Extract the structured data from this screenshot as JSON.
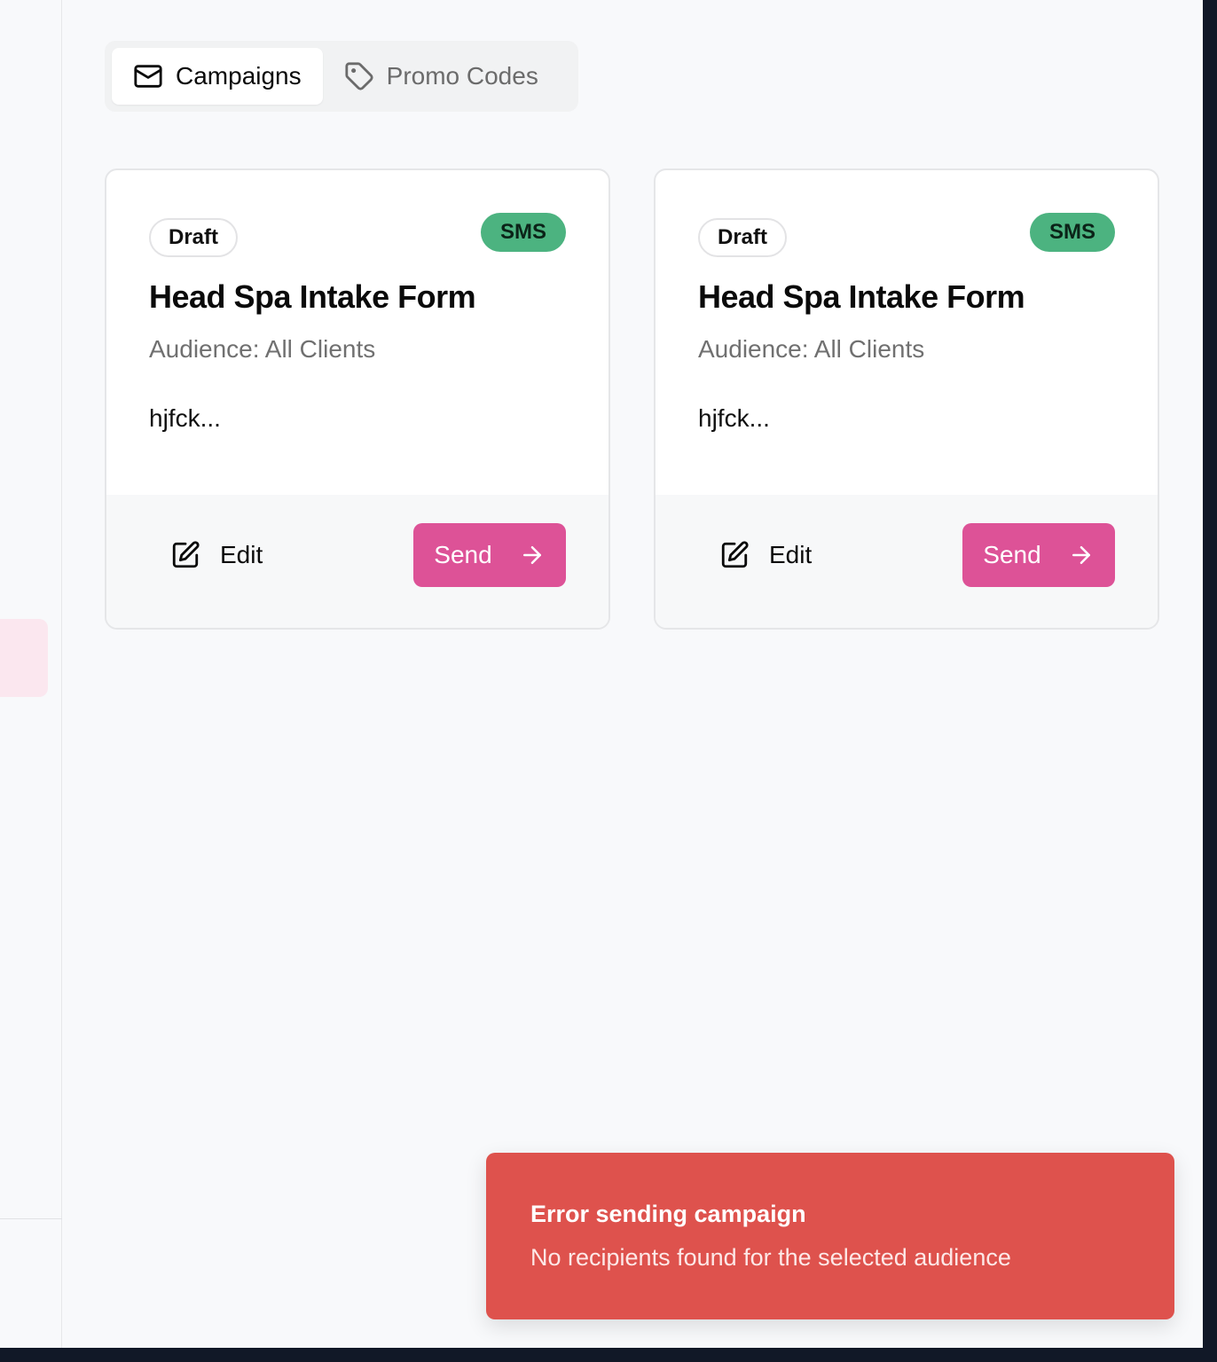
{
  "tabs": [
    {
      "label": "Campaigns",
      "icon": "mail-icon",
      "active": true
    },
    {
      "label": "Promo Codes",
      "icon": "tag-icon",
      "active": false
    }
  ],
  "cards": [
    {
      "status": "Draft",
      "channel": "SMS",
      "title": "Head Spa Intake Form",
      "audience": "Audience: All Clients",
      "preview": "hjfck...",
      "edit_label": "Edit",
      "send_label": "Send"
    },
    {
      "status": "Draft",
      "channel": "SMS",
      "title": "Head Spa Intake Form",
      "audience": "Audience: All Clients",
      "preview": "hjfck...",
      "edit_label": "Edit",
      "send_label": "Send"
    }
  ],
  "toast": {
    "title": "Error sending campaign",
    "message": "No recipients found for the selected audience"
  },
  "colors": {
    "accent": "#dd5297",
    "sms_badge": "#4cb380",
    "error": "#de524d"
  }
}
